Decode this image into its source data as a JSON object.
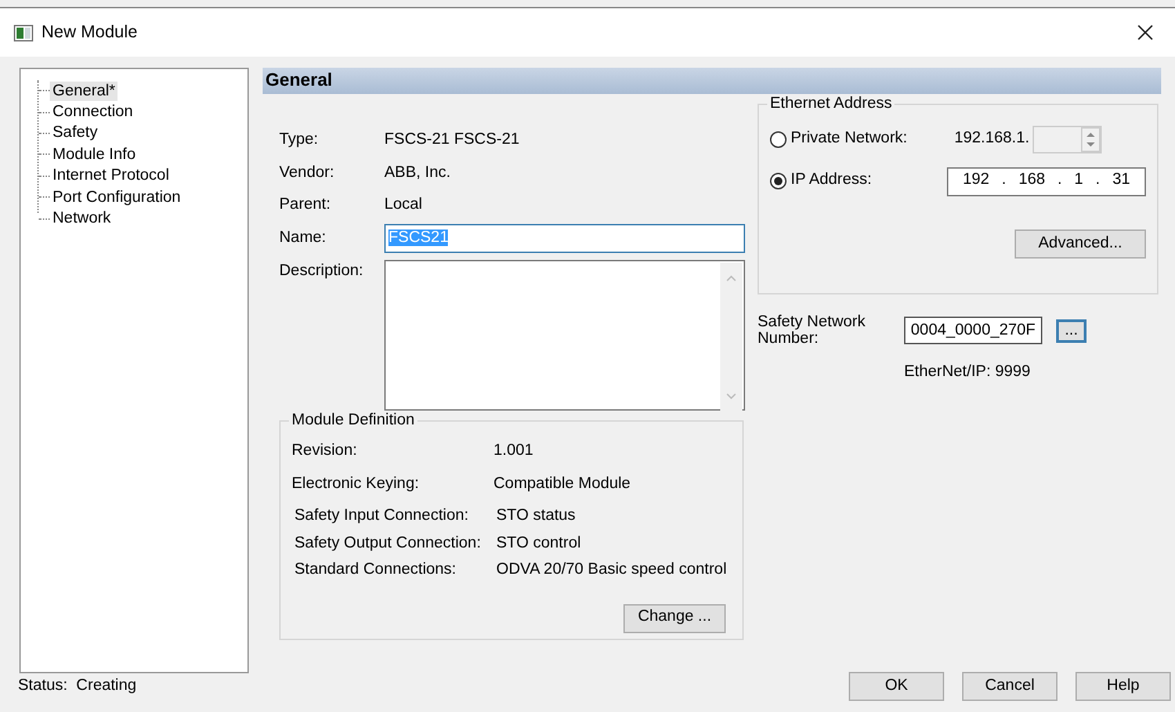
{
  "window": {
    "title": "New Module"
  },
  "tree": {
    "items": [
      {
        "label": "General*",
        "selected": true
      },
      {
        "label": "Connection",
        "selected": false
      },
      {
        "label": "Safety",
        "selected": false
      },
      {
        "label": "Module Info",
        "selected": false
      },
      {
        "label": "Internet Protocol",
        "selected": false
      },
      {
        "label": "Port Configuration",
        "selected": false
      },
      {
        "label": "Network",
        "selected": false
      }
    ]
  },
  "section_title": "General",
  "info": [
    {
      "label": "Type:",
      "value": "FSCS-21 FSCS-21"
    },
    {
      "label": "Vendor:",
      "value": "ABB, Inc."
    },
    {
      "label": "Parent:",
      "value": "Local"
    }
  ],
  "name": {
    "label": "Name:",
    "value": "FSCS21",
    "text_selected": true
  },
  "description": {
    "label": "Description:"
  },
  "module_definition": {
    "title": "Module Definition",
    "groups": [
      [
        {
          "label": "Revision:",
          "value": "1.001"
        },
        {
          "label": "Electronic Keying:",
          "value": "Compatible Module"
        }
      ],
      [
        {
          "label": "Safety Input Connection:",
          "value": "STO status"
        },
        {
          "label": "Safety Output Connection:",
          "value": "STO control"
        },
        {
          "label": "Standard Connections:",
          "value": "ODVA 20/70 Basic speed control"
        }
      ]
    ],
    "change_button": "Change ..."
  },
  "ethernet": {
    "title": "Ethernet Address",
    "options": [
      {
        "kind": "private",
        "label": "Private Network:",
        "selected": false,
        "prefix": "192.168.1."
      },
      {
        "kind": "ip",
        "label": "IP Address:",
        "selected": true,
        "octets": [
          "192",
          "168",
          "1",
          "31"
        ],
        "separator": "."
      }
    ],
    "advanced_button": "Advanced..."
  },
  "safety_network": {
    "label": "Safety Network Number:",
    "value": "0004_0000_270F",
    "browse_button": "..."
  },
  "ethernet_ip": "EtherNet/IP: 9999",
  "status": {
    "label": "Status:",
    "value": "Creating"
  },
  "buttons": [
    "OK",
    "Cancel",
    "Help"
  ]
}
